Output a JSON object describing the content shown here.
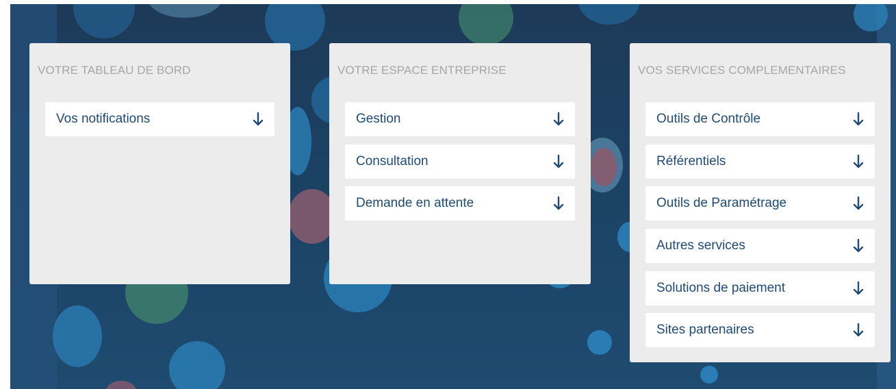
{
  "background": {
    "base_color": "#1d3a58",
    "bubble_colors": [
      "#24669a",
      "#2b7fb8",
      "#3c7a6a",
      "#8a5a6e",
      "#5c8fb0",
      "#2a5f86"
    ]
  },
  "colors": {
    "panel_bg": "#ececec",
    "item_bg": "#ffffff",
    "item_text": "#1f4a75",
    "title_text": "#a6a6a6",
    "arrow": "#1f4a75"
  },
  "panels": [
    {
      "title": "VOTRE TABLEAU DE BORD",
      "items": [
        {
          "label": "Vos notifications",
          "icon": "arrow-down-icon"
        }
      ]
    },
    {
      "title": "VOTRE ESPACE ENTREPRISE",
      "items": [
        {
          "label": "Gestion",
          "icon": "arrow-down-icon"
        },
        {
          "label": "Consultation",
          "icon": "arrow-down-icon"
        },
        {
          "label": "Demande en attente",
          "icon": "arrow-down-icon"
        }
      ]
    },
    {
      "title": "VOS SERVICES COMPLEMENTAIRES",
      "items": [
        {
          "label": "Outils de Contrôle",
          "icon": "arrow-down-icon"
        },
        {
          "label": "Référentiels",
          "icon": "arrow-down-icon"
        },
        {
          "label": "Outils de Paramétrage",
          "icon": "arrow-down-icon"
        },
        {
          "label": "Autres services",
          "icon": "arrow-down-icon"
        },
        {
          "label": "Solutions de paiement",
          "icon": "arrow-down-icon"
        },
        {
          "label": "Sites partenaires",
          "icon": "arrow-down-icon"
        }
      ]
    }
  ]
}
